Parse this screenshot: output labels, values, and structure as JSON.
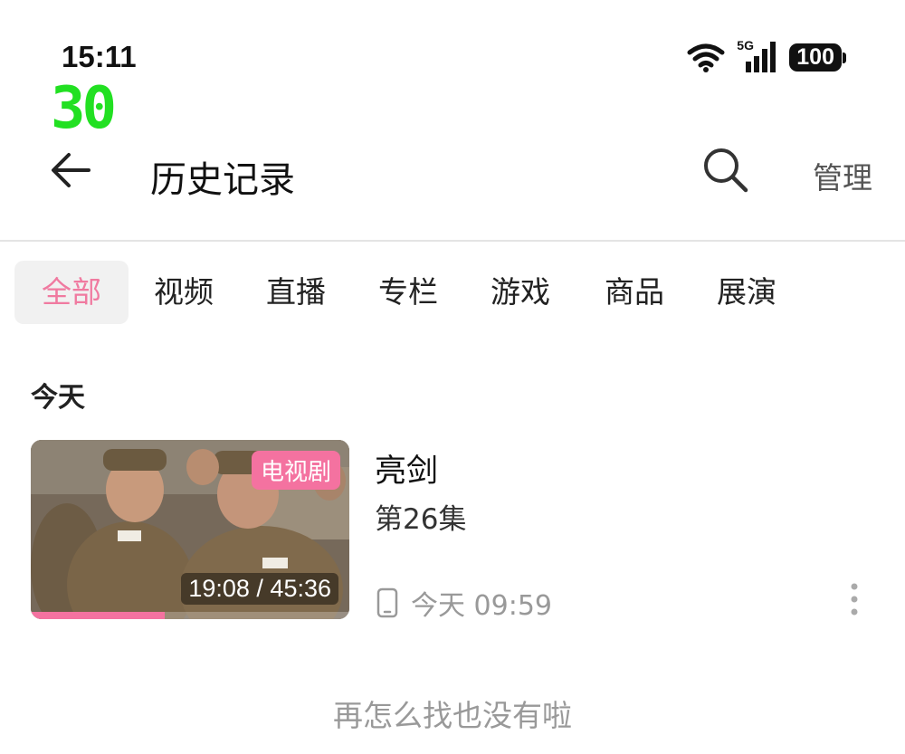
{
  "status_bar": {
    "time": "15:11",
    "network": "5G",
    "battery": "100"
  },
  "fps_counter": "30",
  "header": {
    "title": "历史记录",
    "manage_label": "管理"
  },
  "tabs": [
    {
      "label": "全部",
      "active": true
    },
    {
      "label": "视频",
      "active": false
    },
    {
      "label": "直播",
      "active": false
    },
    {
      "label": "专栏",
      "active": false
    },
    {
      "label": "游戏",
      "active": false
    },
    {
      "label": "商品",
      "active": false
    },
    {
      "label": "展演",
      "active": false
    }
  ],
  "sections": [
    {
      "title": "今天",
      "items": [
        {
          "title": "亮剑",
          "episode": "第26集",
          "badge": "电视剧",
          "watched": "19:08",
          "duration": "19:08 / 45:36",
          "progress": 0.42,
          "device_icon": "phone-icon",
          "last_viewed": "今天 09:59"
        }
      ]
    }
  ],
  "end_message": "再怎么找也没有啦",
  "colors": {
    "accent": "#f472a0",
    "fps": "#22e022",
    "muted": "#999999"
  }
}
